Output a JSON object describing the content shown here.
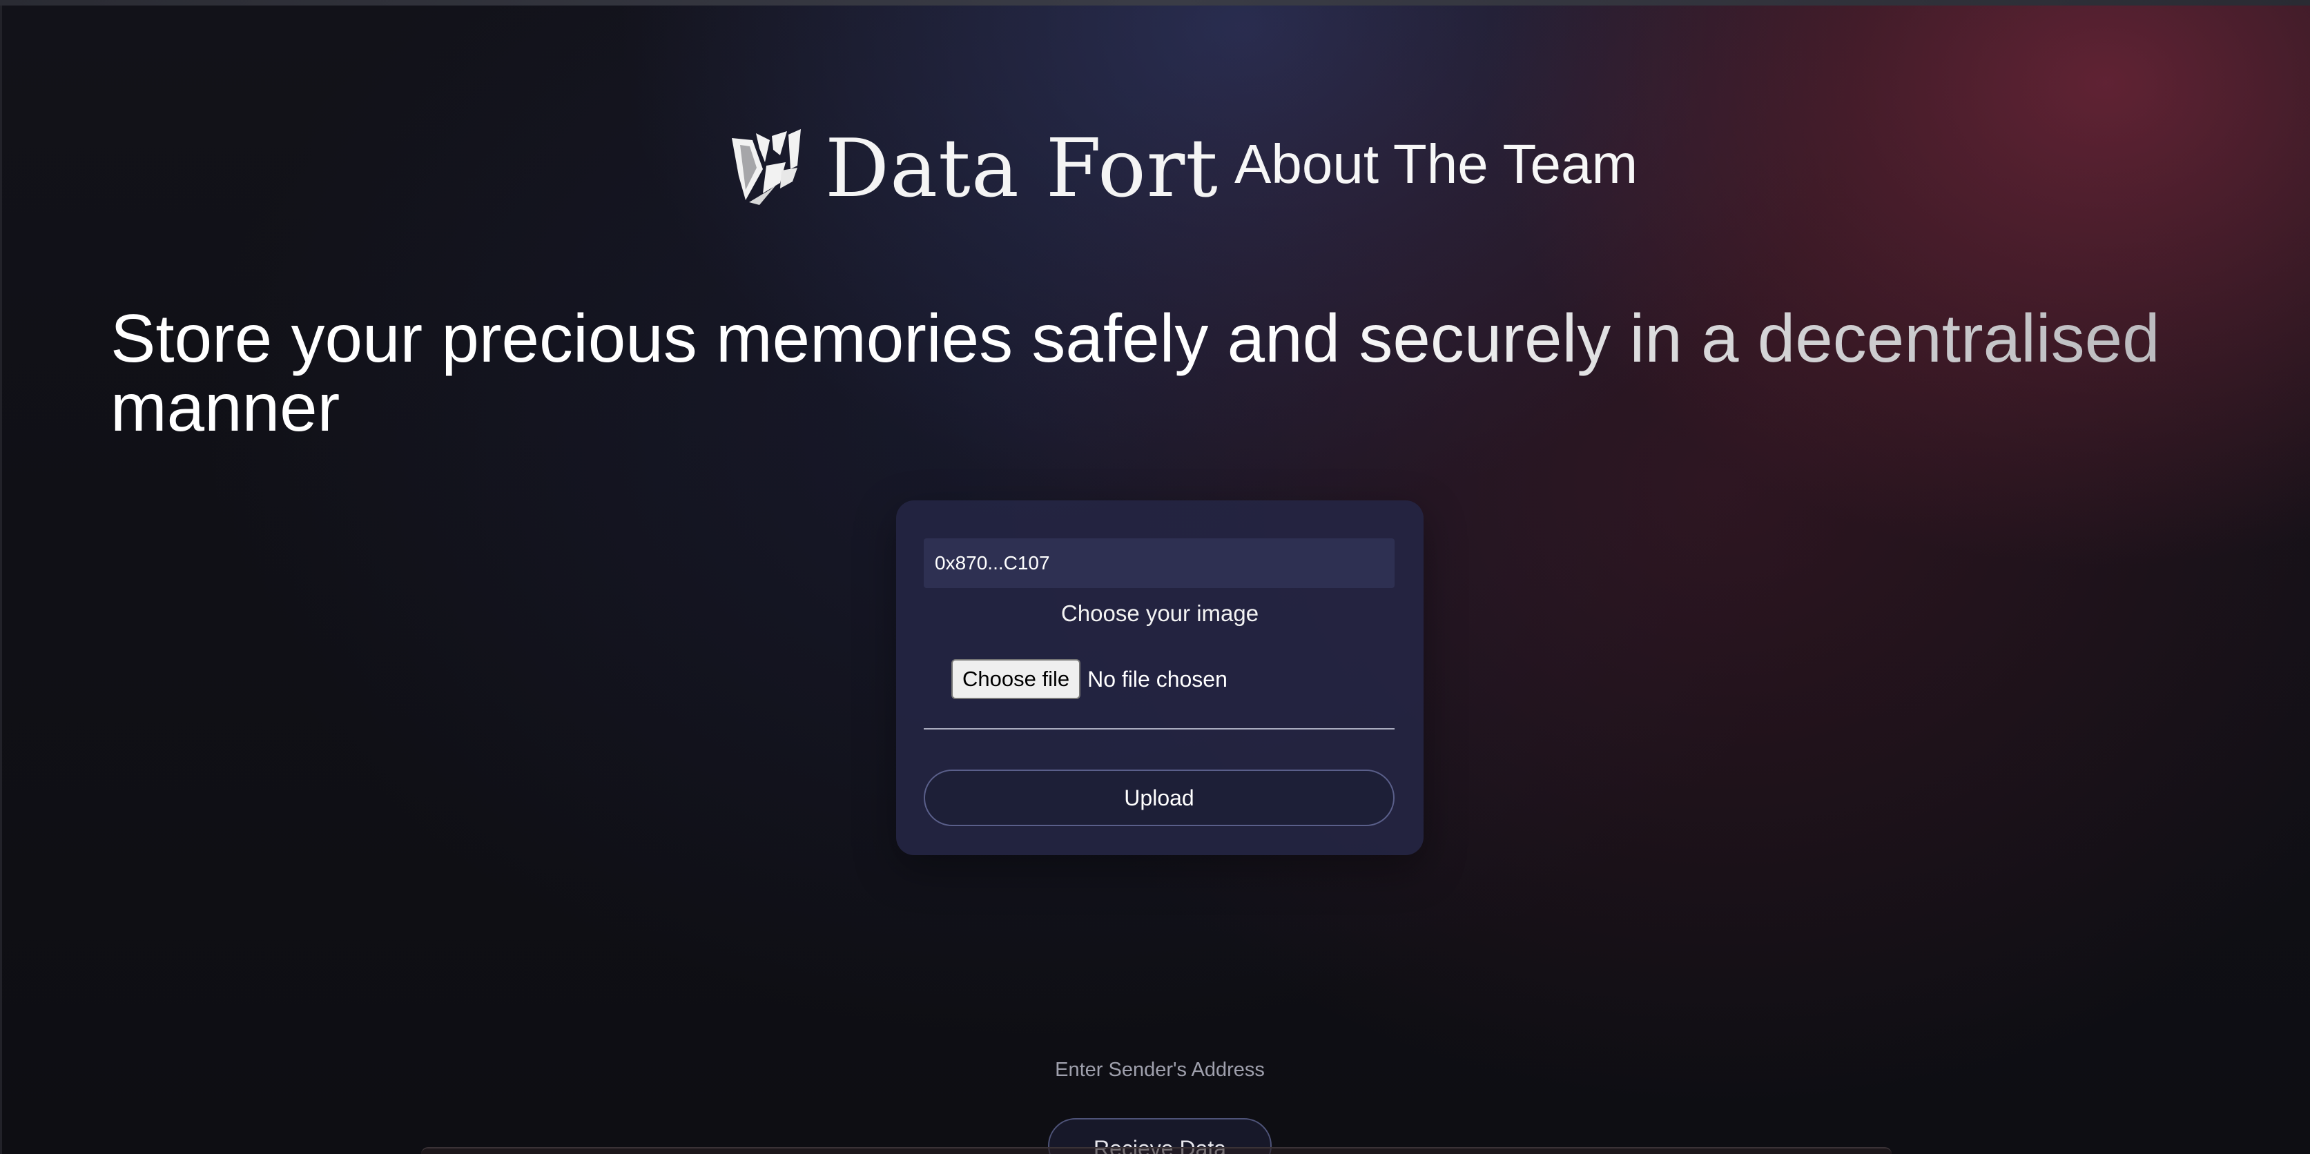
{
  "header": {
    "brand_name": "Data Fort",
    "logo_icon": "data-fort-logo-icon",
    "nav_about": "About The Team"
  },
  "hero": {
    "headline": "Store your precious memories safely and securely in a decentralised manner"
  },
  "upload_card": {
    "wallet_address": "0x870...C107",
    "choose_label": "Choose your image",
    "file_button": "Choose file",
    "file_status": "No file chosen",
    "upload_button": "Upload"
  },
  "receive": {
    "sender_label": "Enter Sender's Address",
    "receive_button": "Recieve Data"
  },
  "colors": {
    "background": "#0e0e13",
    "card": "#242644",
    "accent_red": "#78283c",
    "accent_blue": "#323764"
  }
}
